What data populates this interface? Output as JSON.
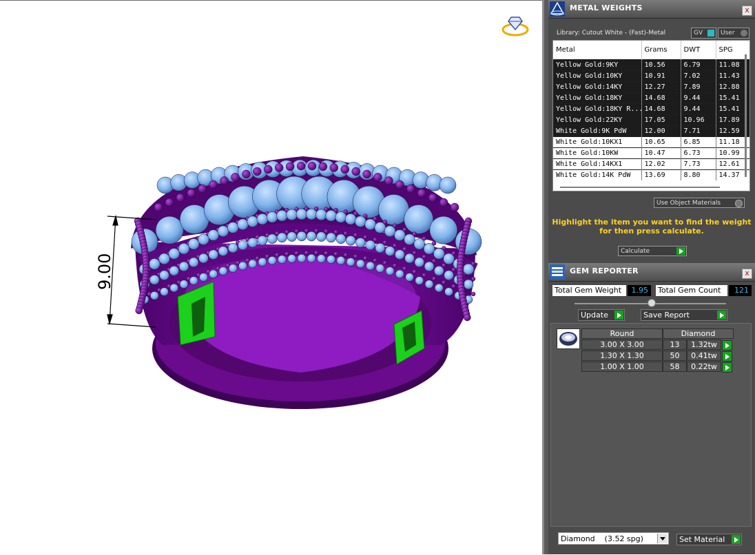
{
  "viewport": {
    "dimension_label": "9.00",
    "logo_icon": "diamond-ring-icon"
  },
  "metal_weights": {
    "title": "METAL WEIGHTS",
    "close_label": "x",
    "library_label": "Library: Cutout White - (Fast)-Metal",
    "gv_label": "GV",
    "user_label": "User",
    "columns": [
      "Metal",
      "Grams",
      "DWT",
      "SPG"
    ],
    "rows": [
      {
        "metal": "Yellow Gold:9KY",
        "grams": "10.56",
        "dwt": "6.79",
        "spg": "11.08"
      },
      {
        "metal": "Yellow Gold:10KY",
        "grams": "10.91",
        "dwt": "7.02",
        "spg": "11.43"
      },
      {
        "metal": "Yellow Gold:14KY",
        "grams": "12.27",
        "dwt": "7.89",
        "spg": "12.88"
      },
      {
        "metal": "Yellow Gold:18KY",
        "grams": "14.68",
        "dwt": "9.44",
        "spg": "15.41"
      },
      {
        "metal": "Yellow Gold:18KY R...",
        "grams": "14.68",
        "dwt": "9.44",
        "spg": "15.41"
      },
      {
        "metal": "Yellow Gold:22KY",
        "grams": "17.05",
        "dwt": "10.96",
        "spg": "17.89"
      },
      {
        "metal": "White Gold:9K PdW",
        "grams": "12.00",
        "dwt": "7.71",
        "spg": "12.59"
      },
      {
        "metal": "White Gold:10KX1",
        "grams": "10.65",
        "dwt": "6.85",
        "spg": "11.18"
      },
      {
        "metal": "White Gold:10KW",
        "grams": "10.47",
        "dwt": "6.73",
        "spg": "10.99"
      },
      {
        "metal": "White Gold:14KX1",
        "grams": "12.02",
        "dwt": "7.73",
        "spg": "12.61"
      },
      {
        "metal": "White Gold:14K PdW",
        "grams": "13.69",
        "dwt": "8.80",
        "spg": "14.37"
      }
    ],
    "use_object_materials": "Use Object Materials",
    "hint_line1": "Highlight the item you want to find the weight",
    "hint_line2": "for then press calculate.",
    "calculate_label": "Calculate"
  },
  "gem_reporter": {
    "title": "GEM REPORTER",
    "close_label": "x",
    "total_weight_label": "Total Gem Weight",
    "total_weight_value": "1.95",
    "total_count_label": "Total Gem Count",
    "total_count_value": "121",
    "update_label": "Update",
    "save_report_label": "Save Report",
    "shape_header": "Round",
    "material_header": "Diamond",
    "gem_rows": [
      {
        "size": "3.00 X 3.00",
        "count": "13",
        "tw": "1.32tw"
      },
      {
        "size": "1.30 X 1.30",
        "count": "50",
        "tw": "0.41tw"
      },
      {
        "size": "1.00 X 1.00",
        "count": "58",
        "tw": "0.22tw"
      }
    ],
    "material_select": "Diamond    (3.52 spg)",
    "set_material_label": "Set Material"
  },
  "colors": {
    "ring_purple": "#6a0a8c",
    "gem_blue": "#7fb2ea",
    "accent_green": "#17a31f",
    "hint_yellow": "#ffd21f"
  }
}
